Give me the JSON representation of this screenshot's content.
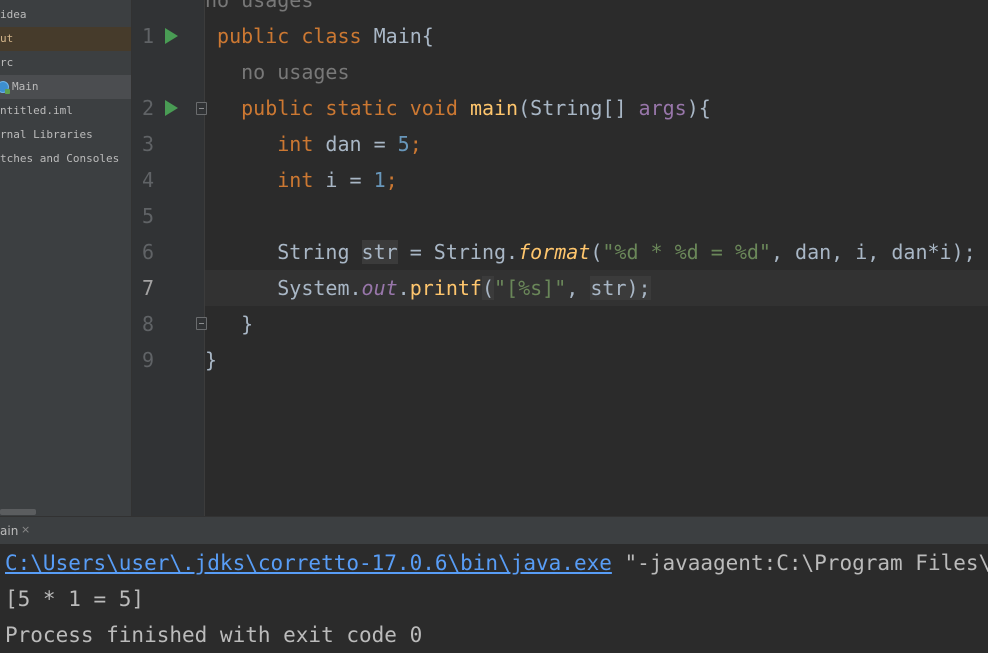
{
  "project_tree": {
    "items": [
      {
        "label": "idea",
        "state": "normal"
      },
      {
        "label": "ut",
        "state": "out"
      },
      {
        "label": "rc",
        "state": "normal"
      },
      {
        "label": "Main",
        "state": "selected",
        "icon": "java-class-icon"
      },
      {
        "label": "ntitled.iml",
        "state": "normal"
      },
      {
        "label": "rnal Libraries",
        "state": "normal"
      },
      {
        "label": "tches and Consoles",
        "state": "normal"
      }
    ]
  },
  "editor": {
    "inlay_hint_top": "no usages",
    "line_numbers": [
      "1",
      "2",
      "3",
      "4",
      "5",
      "6",
      "7",
      "8",
      "9"
    ],
    "current_line": "7",
    "inlay_hint_main": "no usages",
    "lines": {
      "l1": {
        "kw1": "public",
        "kw2": "class",
        "name": "Main{"
      },
      "l2": {
        "kw1": "public",
        "kw2": "static",
        "kw3": "void",
        "fn": "main",
        "open": "(String[] ",
        "param": "args",
        "close": "){"
      },
      "l3": {
        "type": "int",
        "rest": " dan = ",
        "num": "5",
        "semi": ";"
      },
      "l4": {
        "type": "int",
        "rest": " i = ",
        "num": "1",
        "semi": ";"
      },
      "l6": {
        "type": "String ",
        "var": "str",
        "eq": " = String.",
        "fn": "format",
        "p1": "(",
        "str": "\"%d * %d = %d\"",
        "args": ", dan, i, dan*i);"
      },
      "l7": {
        "cls": "System.",
        "field": "out",
        "dot": ".",
        "fn": "printf",
        "p1": "(",
        "str": "\"[%s]\"",
        "comma": ", ",
        "var": "str",
        "close": ");"
      },
      "l8": {
        "text": "}"
      },
      "l9": {
        "text": "}"
      }
    }
  },
  "run_panel": {
    "tab_label": "ain",
    "tab_close": "×",
    "console": {
      "java_path": "C:\\Users\\user\\.jdks\\corretto-17.0.6\\bin\\java.exe",
      "java_args": " \"-javaagent:C:\\Program Files\\JetB",
      "output": "[5 * 1 = 5]",
      "exit": "Process finished with exit code 0"
    }
  },
  "colors": {
    "keyword": "#cc7832",
    "number": "#6897bb",
    "string": "#6a8759",
    "function": "#ffc66d",
    "param": "#9876aa",
    "run_icon": "#499c54",
    "link": "#589df6"
  }
}
